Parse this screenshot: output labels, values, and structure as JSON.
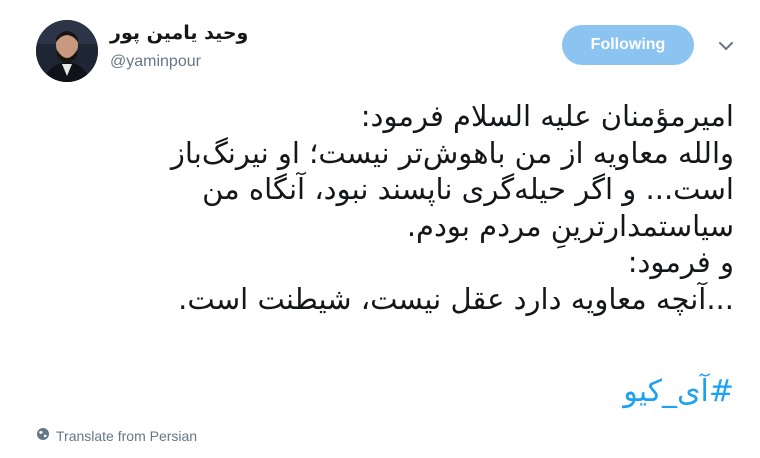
{
  "author": {
    "name": "وحید یامین پور",
    "handle": "@yaminpour"
  },
  "follow_button": {
    "label": "Following",
    "color": "#8bc4f0"
  },
  "menu": {
    "icon": "chevron-down-icon"
  },
  "tweet": {
    "lines": [
      "امیرمؤمنان علیه السلام فرمود:",
      "والله معاویه از من باهوش‌تر نیست؛ او نیرنگ‌باز",
      "است... و اگر حیله‌گری ناپسند نبود، آنگاه من",
      "سیاستمدارترینِ مردم بودم.",
      "و فرمود:",
      "...آنچه معاویه دارد عقل نیست، شیطنت است."
    ],
    "hashtag": "#آی_کیو",
    "hashtag_color": "#1da1f2"
  },
  "translate": {
    "label": "Translate from Persian",
    "icon": "globe-icon"
  }
}
